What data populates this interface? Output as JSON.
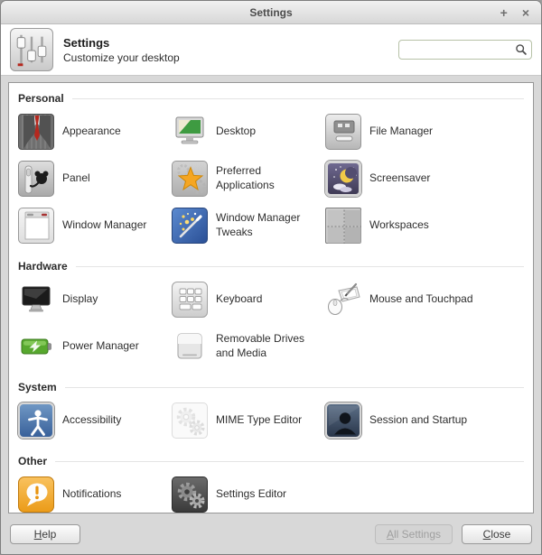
{
  "window": {
    "title": "Settings",
    "maximize_label": "+",
    "close_label": "×"
  },
  "header": {
    "title": "Settings",
    "subtitle": "Customize your desktop",
    "search": {
      "value": "",
      "placeholder": ""
    }
  },
  "sections": [
    {
      "title": "Personal",
      "items": [
        {
          "label": "Appearance",
          "icon": "appearance-icon"
        },
        {
          "label": "Desktop",
          "icon": "desktop-icon"
        },
        {
          "label": "File Manager",
          "icon": "file-manager-icon"
        },
        {
          "label": "Panel",
          "icon": "panel-icon"
        },
        {
          "label": "Preferred Applications",
          "icon": "preferred-applications-icon"
        },
        {
          "label": "Screensaver",
          "icon": "screensaver-icon"
        },
        {
          "label": "Window Manager",
          "icon": "window-manager-icon"
        },
        {
          "label": "Window Manager Tweaks",
          "icon": "window-manager-tweaks-icon"
        },
        {
          "label": "Workspaces",
          "icon": "workspaces-icon"
        }
      ]
    },
    {
      "title": "Hardware",
      "items": [
        {
          "label": "Display",
          "icon": "display-icon"
        },
        {
          "label": "Keyboard",
          "icon": "keyboard-icon"
        },
        {
          "label": "Mouse and Touchpad",
          "icon": "mouse-touchpad-icon"
        },
        {
          "label": "Power Manager",
          "icon": "power-manager-icon"
        },
        {
          "label": "Removable Drives and Media",
          "icon": "removable-drives-icon"
        }
      ]
    },
    {
      "title": "System",
      "items": [
        {
          "label": "Accessibility",
          "icon": "accessibility-icon"
        },
        {
          "label": "MIME Type Editor",
          "icon": "mime-type-icon"
        },
        {
          "label": "Session and Startup",
          "icon": "session-startup-icon"
        }
      ]
    },
    {
      "title": "Other",
      "items": [
        {
          "label": "Notifications",
          "icon": "notifications-icon"
        },
        {
          "label": "Settings Editor",
          "icon": "settings-editor-icon"
        }
      ]
    }
  ],
  "footer": {
    "help_label": "Help",
    "all_settings_label": "All Settings",
    "all_settings_disabled": true,
    "close_label": "Close"
  },
  "colors": {
    "search_border": "#b7c2a7",
    "notification_orange": "#eb9c19",
    "accessibility_blue": "#3c659c",
    "power_green": "#57a82e",
    "disabled_text": "#9f9f9f"
  }
}
